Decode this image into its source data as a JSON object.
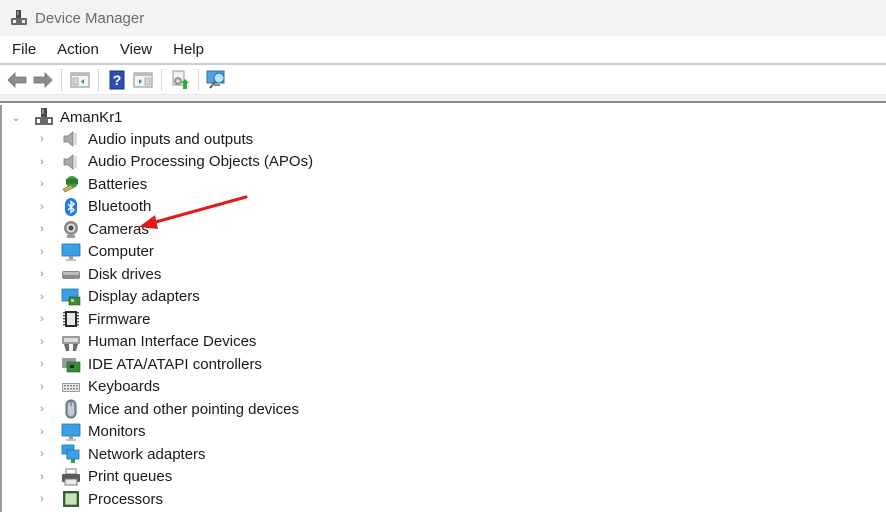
{
  "window": {
    "title": "Device Manager",
    "icon": "device-manager-icon"
  },
  "menu": [
    "File",
    "Action",
    "View",
    "Help"
  ],
  "toolbar": {
    "buttons": [
      {
        "name": "back-button",
        "icon": "arrow-left-icon"
      },
      {
        "name": "forward-button",
        "icon": "arrow-right-icon"
      },
      {
        "name": "show-hide-console-tree-button",
        "icon": "console-tree-icon"
      },
      {
        "name": "help-button",
        "icon": "help-icon"
      },
      {
        "name": "show-hide-action-pane-button",
        "icon": "action-pane-icon"
      },
      {
        "name": "update-driver-button",
        "icon": "update-driver-icon"
      },
      {
        "name": "scan-hardware-changes-button",
        "icon": "scan-hardware-icon"
      }
    ]
  },
  "tree": {
    "root": {
      "label": "AmanKr1",
      "expanded": true,
      "icon": "computer-tower-icon"
    },
    "children": [
      {
        "label": "Audio inputs and outputs",
        "icon": "speaker-icon"
      },
      {
        "label": "Audio Processing Objects (APOs)",
        "icon": "speaker-icon"
      },
      {
        "label": "Batteries",
        "icon": "battery-icon"
      },
      {
        "label": "Bluetooth",
        "icon": "bluetooth-icon"
      },
      {
        "label": "Cameras",
        "icon": "camera-icon",
        "highlighted_by_arrow": true
      },
      {
        "label": "Computer",
        "icon": "monitor-icon"
      },
      {
        "label": "Disk drives",
        "icon": "disk-drive-icon"
      },
      {
        "label": "Display adapters",
        "icon": "display-adapter-icon"
      },
      {
        "label": "Firmware",
        "icon": "chip-icon"
      },
      {
        "label": "Human Interface Devices",
        "icon": "hid-icon"
      },
      {
        "label": "IDE ATA/ATAPI controllers",
        "icon": "ide-controller-icon"
      },
      {
        "label": "Keyboards",
        "icon": "keyboard-icon"
      },
      {
        "label": "Mice and other pointing devices",
        "icon": "mouse-icon"
      },
      {
        "label": "Monitors",
        "icon": "monitor-icon"
      },
      {
        "label": "Network adapters",
        "icon": "network-adapter-icon"
      },
      {
        "label": "Print queues",
        "icon": "printer-icon"
      },
      {
        "label": "Processors",
        "icon": "processor-icon"
      }
    ]
  },
  "annotation": {
    "type": "arrow",
    "color": "#e01b1b",
    "points_to": "Cameras"
  }
}
